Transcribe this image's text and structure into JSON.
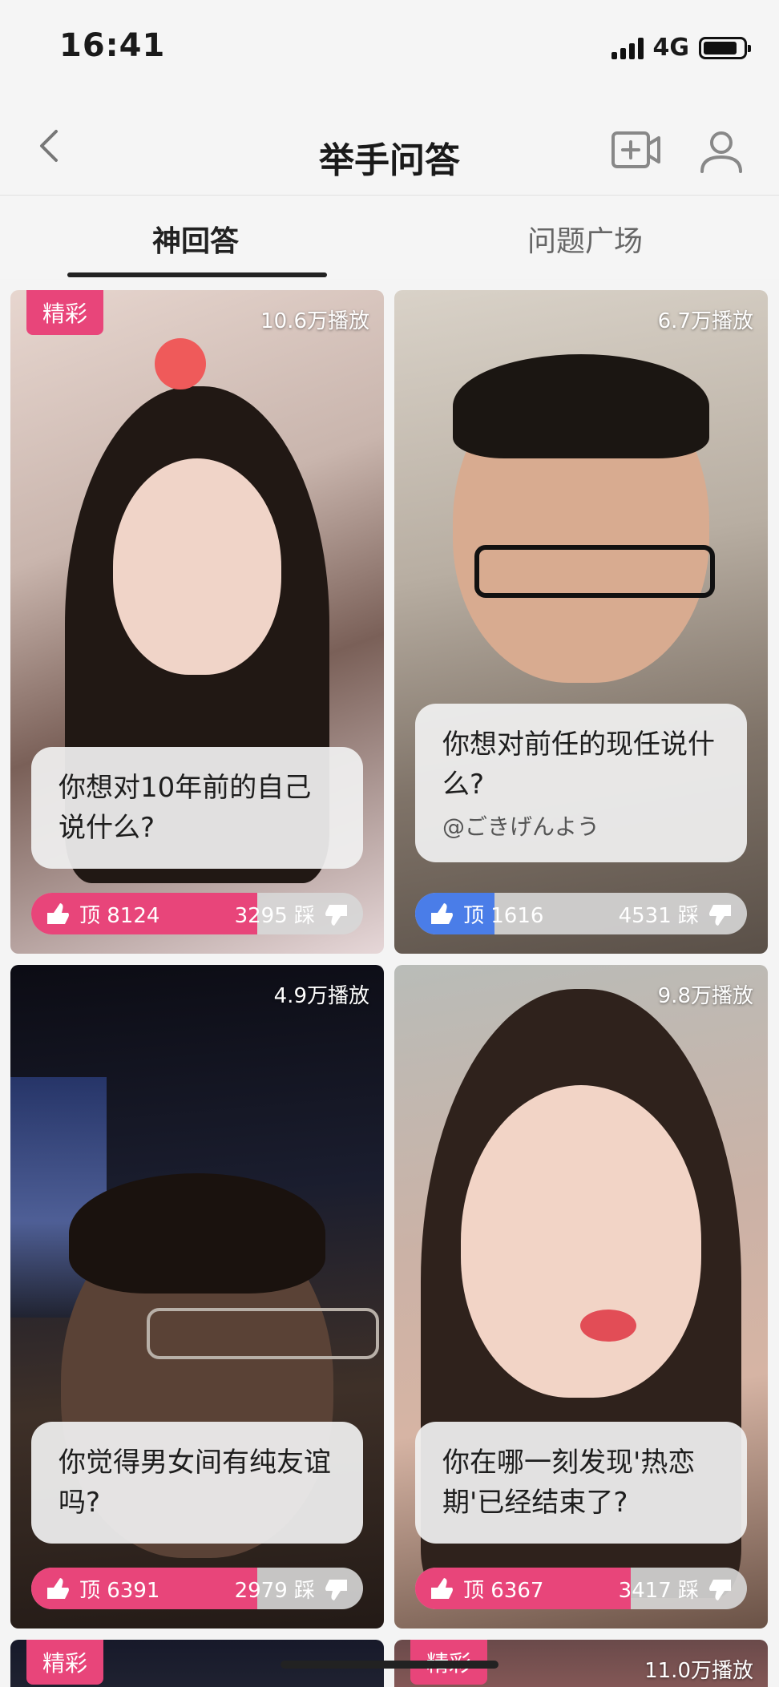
{
  "status": {
    "time": "16:41",
    "network": "4G",
    "battery_level": 0.85
  },
  "nav": {
    "title": "举手问答",
    "back_icon": "chevron-left-icon",
    "video_icon": "video-plus-icon",
    "user_icon": "user-icon"
  },
  "tabs": [
    {
      "label": "神回答",
      "active": true
    },
    {
      "label": "问题广场",
      "active": false
    }
  ],
  "cards": [
    {
      "badge": "精彩",
      "plays": "10.6万播放",
      "question": "你想对10年前的自己说什么?",
      "subtitle": "",
      "up": "顶 8124",
      "down": "3295 踩",
      "up_ratio": 0.68,
      "up_color": "#e8457a"
    },
    {
      "badge": "",
      "plays": "6.7万播放",
      "question": "你想对前任的现任说什么?",
      "subtitle": "@ごきげんよう",
      "up": "顶 1616",
      "down": "4531 踩",
      "up_ratio": 0.24,
      "up_color": "#4a7de8"
    },
    {
      "badge": "",
      "plays": "4.9万播放",
      "question": "你觉得男女间有纯友谊吗?",
      "subtitle": "",
      "up": "顶 6391",
      "down": "2979 踩",
      "up_ratio": 0.68,
      "up_color": "#e8457a"
    },
    {
      "badge": "",
      "plays": "9.8万播放",
      "question": "你在哪一刻发现'热恋期'已经结束了?",
      "subtitle": "",
      "up": "顶 6367",
      "down": "3417 踩",
      "up_ratio": 0.65,
      "up_color": "#e8457a"
    },
    {
      "badge": "精彩",
      "plays": "",
      "question": "",
      "subtitle": "",
      "up": "",
      "down": ""
    },
    {
      "badge": "精彩",
      "plays": "11.0万播放",
      "question": "",
      "subtitle": "",
      "up": "",
      "down": ""
    }
  ]
}
